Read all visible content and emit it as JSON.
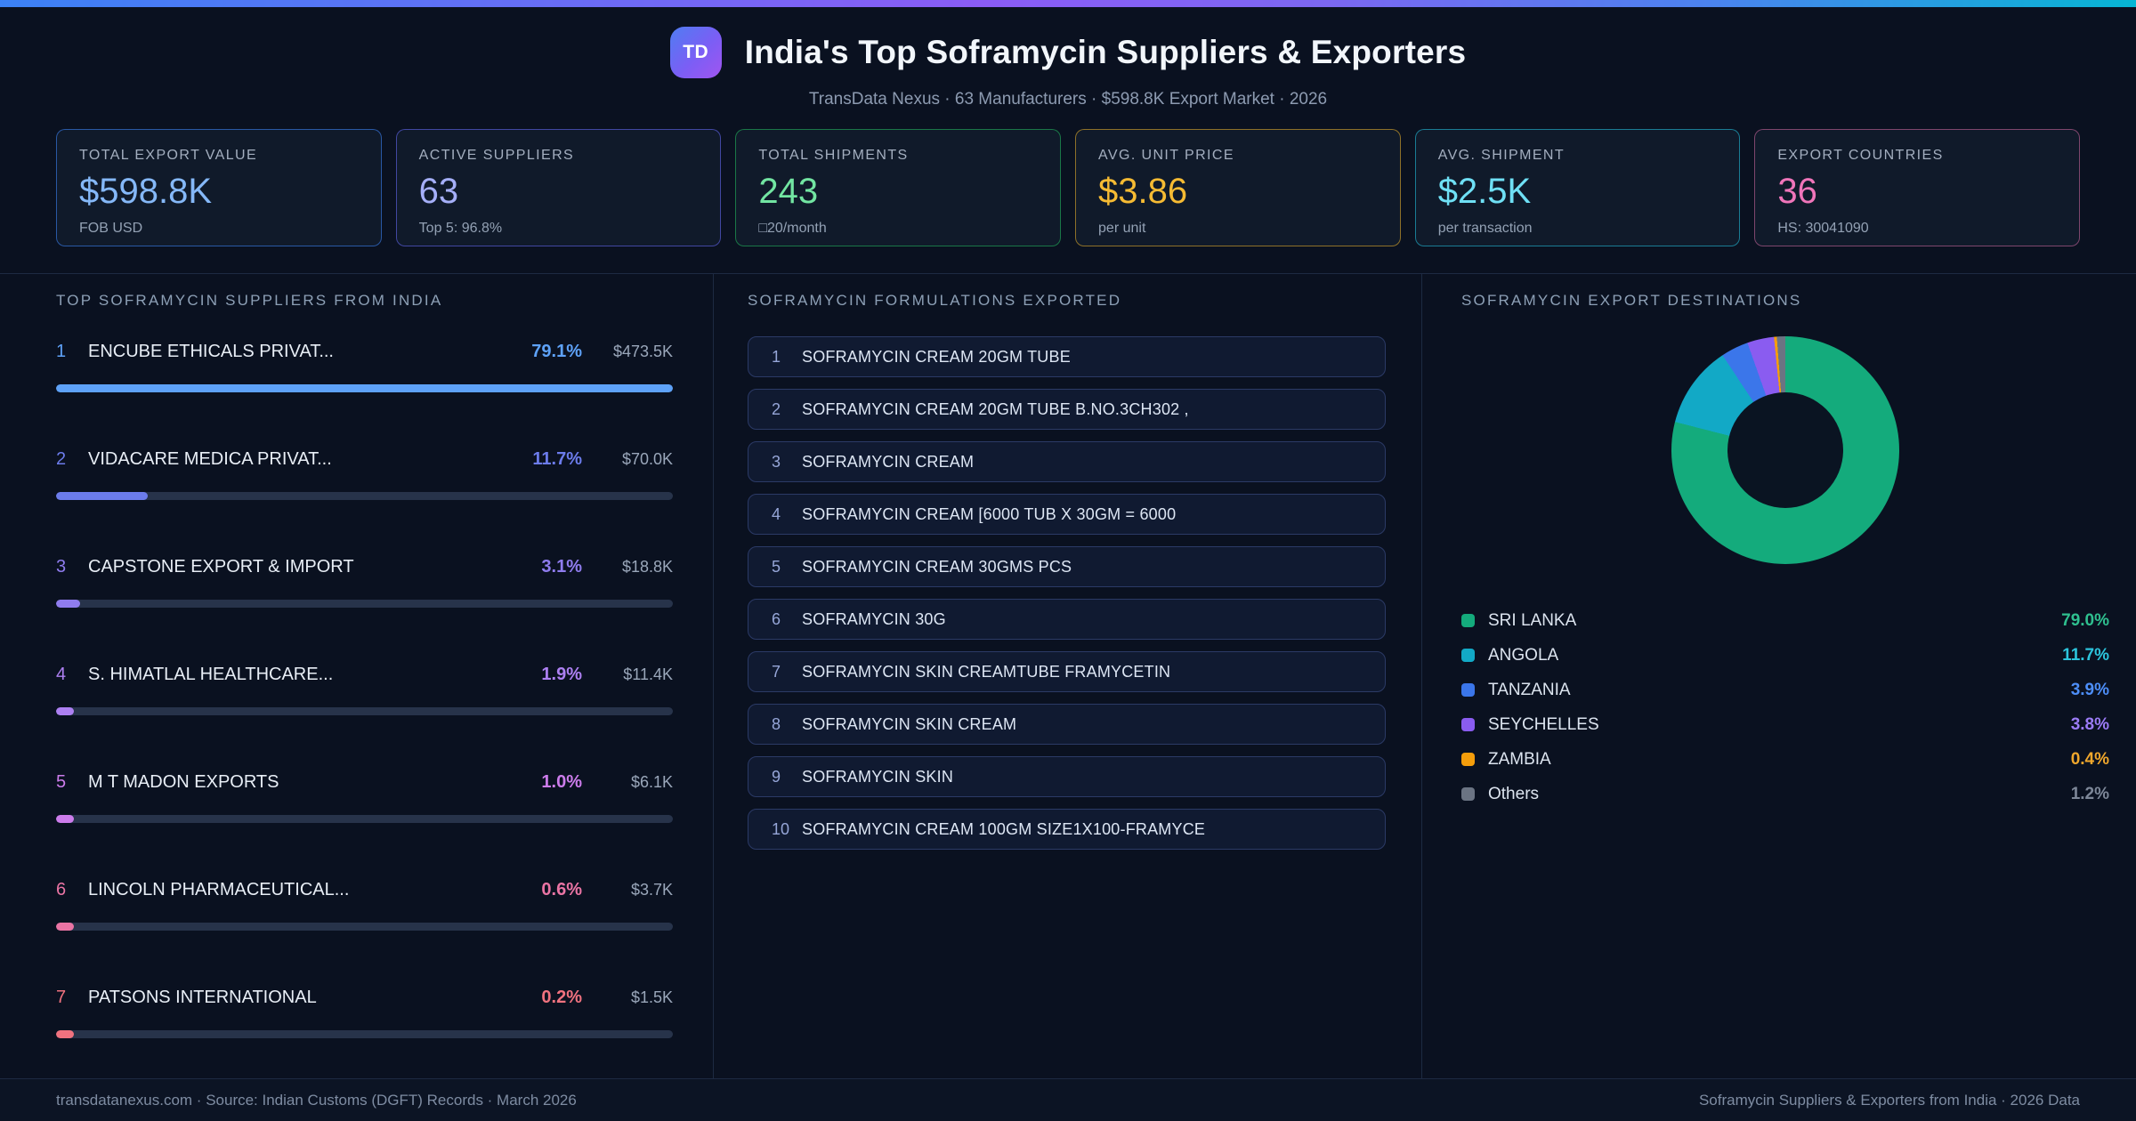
{
  "header": {
    "badge": "TD",
    "title": "India's Top Soframycin Suppliers & Exporters",
    "subtitle": "TransData Nexus · 63 Manufacturers · $598.8K Export Market · 2026"
  },
  "stats": [
    {
      "label": "TOTAL EXPORT VALUE",
      "value": "$598.8K",
      "sub": "FOB USD",
      "value_color": "#85b8f8",
      "border_color": "rgba(59,130,246,0.6)"
    },
    {
      "label": "ACTIVE SUPPLIERS",
      "value": "63",
      "sub": "Top 5: 96.8%",
      "value_color": "#a5aff8",
      "border_color": "rgba(99,102,241,0.6)"
    },
    {
      "label": "TOTAL SHIPMENTS",
      "value": "243",
      "sub": "□20/month",
      "value_color": "#72e5a2",
      "border_color": "rgba(34,197,94,0.55)"
    },
    {
      "label": "AVG. UNIT PRICE",
      "value": "$3.86",
      "sub": "per unit",
      "value_color": "#f6bb33",
      "border_color": "rgba(245,185,40,0.55)"
    },
    {
      "label": "AVG. SHIPMENT",
      "value": "$2.5K",
      "sub": "per transaction",
      "value_color": "#6fe0f5",
      "border_color": "rgba(34,190,220,0.6)"
    },
    {
      "label": "EXPORT COUNTRIES",
      "value": "36",
      "sub": "HS: 30041090",
      "value_color": "#f075ba",
      "border_color": "rgba(236,114,176,0.5)"
    }
  ],
  "suppliers": {
    "section_title": "TOP SOFRAMYCIN SUPPLIERS FROM INDIA",
    "max_share_pct": 79.1,
    "rows": [
      {
        "rank": "1",
        "name": "ENCUBE ETHICALS PRIVAT...",
        "pct_label": "79.1%",
        "share_pct": 79.1,
        "value": "$473.5K",
        "color": "#5ea2f8"
      },
      {
        "rank": "2",
        "name": "VIDACARE MEDICA PRIVAT...",
        "pct_label": "11.7%",
        "share_pct": 11.7,
        "value": "$70.0K",
        "color": "#6c7ceb"
      },
      {
        "rank": "3",
        "name": "CAPSTONE EXPORT & IMPORT",
        "pct_label": "3.1%",
        "share_pct": 3.1,
        "value": "$18.8K",
        "color": "#8f7cee"
      },
      {
        "rank": "4",
        "name": "S. HIMATLAL HEALTHCARE...",
        "pct_label": "1.9%",
        "share_pct": 1.9,
        "value": "$11.4K",
        "color": "#ad80f2"
      },
      {
        "rank": "5",
        "name": "M T MADON EXPORTS",
        "pct_label": "1.0%",
        "share_pct": 1.0,
        "value": "$6.1K",
        "color": "#cc7ceb"
      },
      {
        "rank": "6",
        "name": "LINCOLN PHARMACEUTICAL...",
        "pct_label": "0.6%",
        "share_pct": 0.6,
        "value": "$3.7K",
        "color": "#ea74a4"
      },
      {
        "rank": "7",
        "name": "PATSONS INTERNATIONAL",
        "pct_label": "0.2%",
        "share_pct": 0.2,
        "value": "$1.5K",
        "color": "#f0727f"
      }
    ]
  },
  "formulations": {
    "section_title": "SOFRAMYCIN FORMULATIONS EXPORTED",
    "items": [
      {
        "num": "1",
        "text": "SOFRAMYCIN CREAM 20GM TUBE"
      },
      {
        "num": "2",
        "text": "SOFRAMYCIN CREAM 20GM TUBE B.NO.3CH302 ,"
      },
      {
        "num": "3",
        "text": "SOFRAMYCIN CREAM"
      },
      {
        "num": "4",
        "text": "SOFRAMYCIN CREAM [6000 TUB X 30GM = 6000"
      },
      {
        "num": "5",
        "text": "SOFRAMYCIN CREAM 30GMS PCS"
      },
      {
        "num": "6",
        "text": "SOFRAMYCIN 30G"
      },
      {
        "num": "7",
        "text": "SOFRAMYCIN SKIN CREAMTUBE FRAMYCETIN"
      },
      {
        "num": "8",
        "text": "SOFRAMYCIN SKIN CREAM"
      },
      {
        "num": "9",
        "text": "SOFRAMYCIN SKIN"
      },
      {
        "num": "10",
        "text": "SOFRAMYCIN CREAM 100GM SIZE1X100-FRAMYCE"
      }
    ]
  },
  "destinations": {
    "section_title": "SOFRAMYCIN EXPORT DESTINATIONS",
    "hole_color": "#0a1422"
  },
  "chart_data": {
    "type": "pie",
    "donut": true,
    "title": "SOFRAMYCIN EXPORT DESTINATIONS",
    "legend_position": "bottom",
    "labels": [
      "SRI LANKA",
      "ANGOLA",
      "TANZANIA",
      "SEYCHELLES",
      "ZAMBIA",
      "Others"
    ],
    "values": [
      79.0,
      11.7,
      3.9,
      3.8,
      0.4,
      1.2
    ],
    "pct_labels": [
      "79.0%",
      "11.7%",
      "3.9%",
      "3.8%",
      "0.4%",
      "1.2%"
    ],
    "colors": [
      "#14ab7c",
      "#12a9c6",
      "#3b76ea",
      "#8a5cf0",
      "#f59e0b",
      "#6b7483"
    ],
    "pct_text_colors": [
      "#2fc08f",
      "#2cc4dc",
      "#4d8ef8",
      "#9b7bf6",
      "#f0a72c",
      "#7d8798"
    ]
  },
  "footer": {
    "left": "transdatanexus.com · Source: Indian Customs (DGFT) Records · March 2026",
    "right": "Soframycin Suppliers & Exporters from India · 2026 Data"
  }
}
